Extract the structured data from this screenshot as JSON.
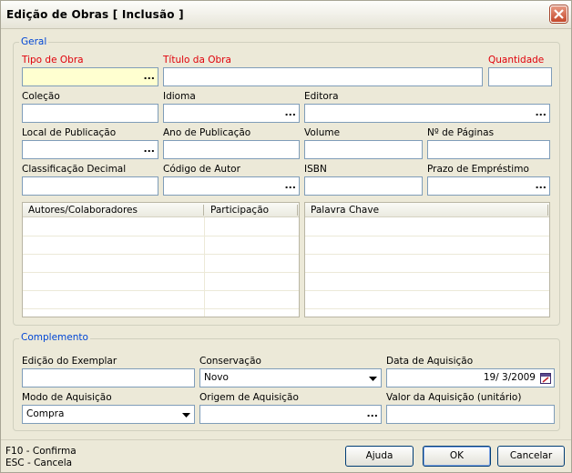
{
  "window": {
    "title": "Edição de Obras [ Inclusão ]"
  },
  "geral": {
    "legend": "Geral",
    "tipo_obra_label": "Tipo de Obra",
    "titulo_obra_label": "Título da Obra",
    "quantidade_label": "Quantidade",
    "colecao_label": "Coleção",
    "idioma_label": "Idioma",
    "editora_label": "Editora",
    "local_publicacao_label": "Local de Publicação",
    "ano_publicacao_label": "Ano de Publicação",
    "volume_label": "Volume",
    "num_paginas_label": "Nº de Páginas",
    "classificacao_label": "Classificação Decimal",
    "codigo_autor_label": "Código de Autor",
    "isbn_label": "ISBN",
    "prazo_emprestimo_label": "Prazo de Empréstimo",
    "lookup_glyph": "...",
    "autores_grid": {
      "col1": "Autores/Colaboradores",
      "col2": "Participação"
    },
    "palavra_grid": {
      "col1": "Palavra Chave"
    }
  },
  "complemento": {
    "legend": "Complemento",
    "edicao_label": "Edição do Exemplar",
    "conservacao_label": "Conservação",
    "conservacao_value": "Novo",
    "data_aquisicao_label": "Data de Aquisição",
    "data_aquisicao_value": "19/ 3/2009",
    "modo_aquisicao_label": "Modo de Aquisição",
    "modo_aquisicao_value": "Compra",
    "origem_aquisicao_label": "Origem de Aquisição",
    "valor_aquisicao_label": "Valor da Aquisição (unitário)"
  },
  "footer": {
    "hint_f10": "F10 - Confirma",
    "hint_esc": "ESC - Cancela",
    "ajuda_label": "Ajuda",
    "ok_label": "OK",
    "cancelar_label": "Cancelar"
  },
  "colors": {
    "required_label": "#e0000a",
    "group_legend": "#0046d5",
    "window_bg": "#ece9d8"
  },
  "icons": [
    "close-icon",
    "ellipsis-icon",
    "dropdown-arrow-icon",
    "calendar-icon"
  ]
}
